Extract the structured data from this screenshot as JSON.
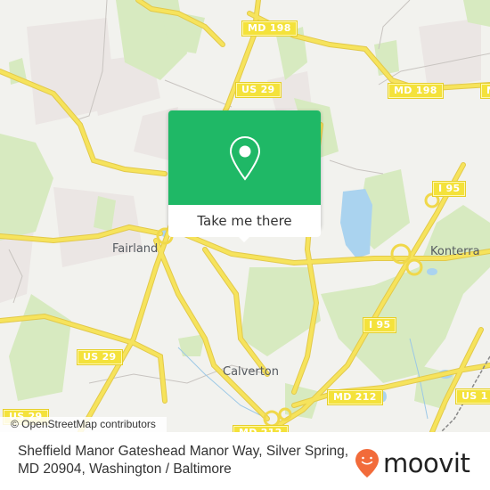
{
  "map": {
    "colors": {
      "background": "#f2f2ee",
      "park": "#d7eac0",
      "residential": "#ebe6e4",
      "water": "#aad3ef",
      "road": "#f6e35c",
      "road_edge": "#e2c94a"
    },
    "route_shields": [
      {
        "label": "MD 198"
      },
      {
        "label": "US 29"
      },
      {
        "label": "MD 198"
      },
      {
        "label": "MD"
      },
      {
        "label": "I 95"
      },
      {
        "label": "I 95"
      },
      {
        "label": "US 29"
      },
      {
        "label": "US 29"
      },
      {
        "label": "MD 212"
      },
      {
        "label": "MD 212"
      },
      {
        "label": "US 1"
      }
    ],
    "places": [
      {
        "label": "Fairland"
      },
      {
        "label": "Konterra"
      },
      {
        "label": "Calverton"
      }
    ],
    "attribution": "© OpenStreetMap contributors"
  },
  "popup": {
    "icon": "location-pin-icon",
    "button_label": "Take me there",
    "accent": "#1fb866"
  },
  "footer": {
    "address": "Sheffield Manor Gateshead Manor Way, Silver Spring, MD 20904, Washington / Baltimore",
    "brand": "moovit",
    "brand_color": "#f26b3a"
  }
}
